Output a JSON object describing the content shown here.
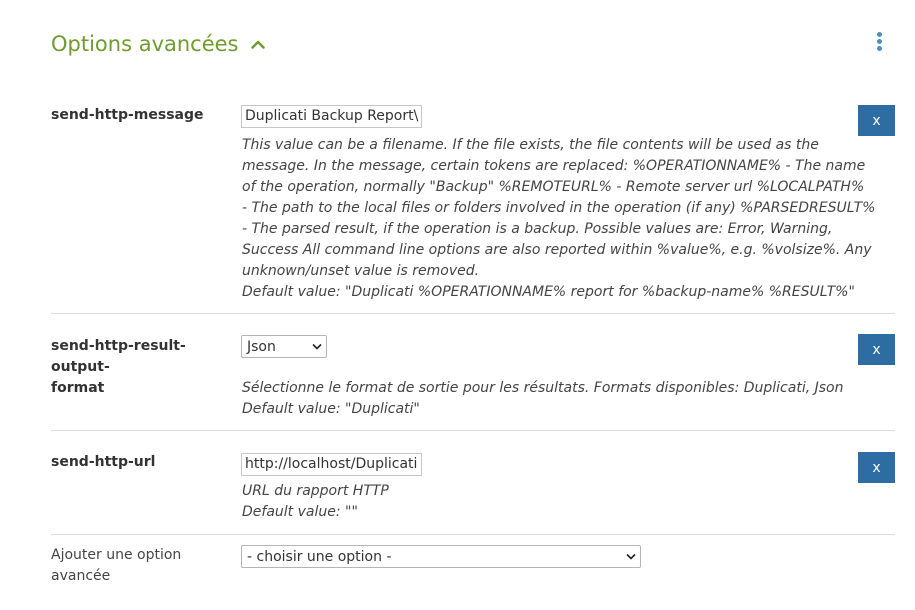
{
  "header": {
    "title": "Options avancées",
    "collapse_icon": "chevron-up-icon",
    "menu_icon": "kebab-menu-icon",
    "accent_color": "#6f9c2f",
    "menu_color": "#4a8fc8"
  },
  "options": [
    {
      "label": "send-http-message",
      "input_value": "Duplicati Backup Report\\",
      "description_lines": [
        "This value can be a filename. If the file exists, the file contents will be used as the",
        "message. In the message, certain tokens are replaced: %OPERATIONNAME% - The name",
        "of the operation, normally \"Backup\" %REMOTEURL% - Remote server url %LOCALPATH%",
        "- The path to the local files or folders involved in the operation (if any) %PARSEDRESULT%",
        "- The parsed result, if the operation is a backup. Possible values are: Error, Warning,",
        "Success All command line options are also reported within %value%, e.g. %volsize%. Any",
        "unknown/unset value is removed."
      ],
      "default_value": "Default value: \"Duplicati %OPERATIONNAME% report for %backup-name% %RESULT%\"",
      "remove_label": "x"
    },
    {
      "label_line1": "send-http-result-output-",
      "label_line2": "format",
      "select_value": "Json",
      "description_lines": [
        "Sélectionne le format de sortie pour les résultats. Formats disponibles: Duplicati, Json"
      ],
      "default_value": "Default value: \"Duplicati\"",
      "remove_label": "x"
    },
    {
      "label": "send-http-url",
      "input_value": "http://localhost/Duplicati",
      "description_lines": [
        "URL du rapport HTTP"
      ],
      "default_value": "Default value: \"\"",
      "remove_label": "x"
    }
  ],
  "add_option": {
    "label_line1": "Ajouter une option",
    "label_line2": "avancée",
    "select_value": "- choisir une option -"
  },
  "button_color": "#2e6da4"
}
